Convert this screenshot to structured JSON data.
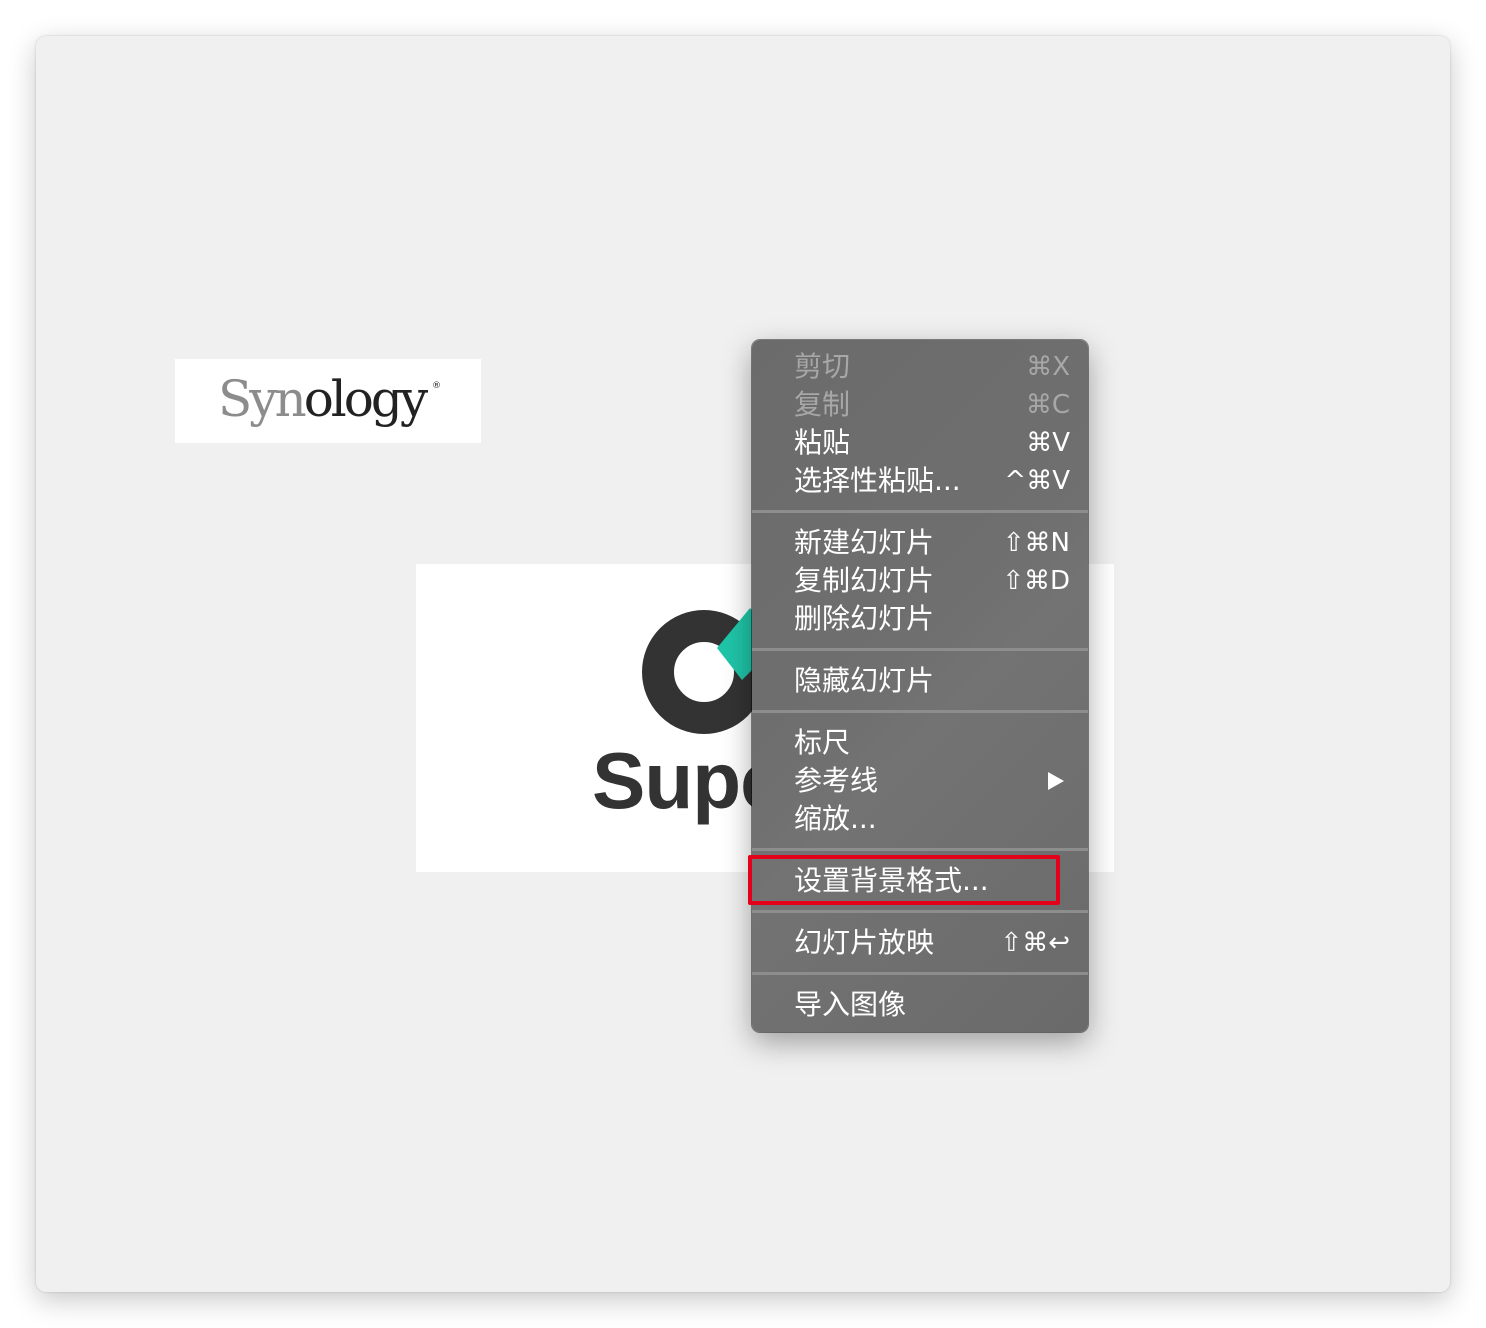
{
  "slide_logos": {
    "synology_text": "Synology",
    "synology_mark": "®",
    "supe_text": "Supe"
  },
  "context_menu": {
    "items": [
      {
        "label": "剪切",
        "shortcut": "⌘X",
        "enabled": false
      },
      {
        "label": "复制",
        "shortcut": "⌘C",
        "enabled": false
      },
      {
        "label": "粘贴",
        "shortcut": "⌘V",
        "enabled": true
      },
      {
        "label": "选择性粘贴...",
        "shortcut": "^⌘V",
        "enabled": true
      },
      {
        "label": "新建幻灯片",
        "shortcut": "⇧⌘N",
        "enabled": true
      },
      {
        "label": "复制幻灯片",
        "shortcut": "⇧⌘D",
        "enabled": true
      },
      {
        "label": "删除幻灯片",
        "shortcut": "",
        "enabled": true
      },
      {
        "label": "隐藏幻灯片",
        "shortcut": "",
        "enabled": true
      },
      {
        "label": "标尺",
        "shortcut": "",
        "enabled": true
      },
      {
        "label": "参考线",
        "shortcut": "",
        "enabled": true,
        "submenu": "submenu-arrow-icon"
      },
      {
        "label": "缩放...",
        "shortcut": "",
        "enabled": true
      },
      {
        "label": "设置背景格式...",
        "shortcut": "",
        "enabled": true,
        "highlighted": true
      },
      {
        "label": "幻灯片放映",
        "shortcut": "⇧⌘↩",
        "enabled": true
      },
      {
        "label": "导入图像",
        "shortcut": "",
        "enabled": true
      }
    ]
  },
  "colors": {
    "highlight_outline": "#e3001b",
    "logo_teal": "#1fc5a8",
    "logo_dark": "#333333"
  }
}
